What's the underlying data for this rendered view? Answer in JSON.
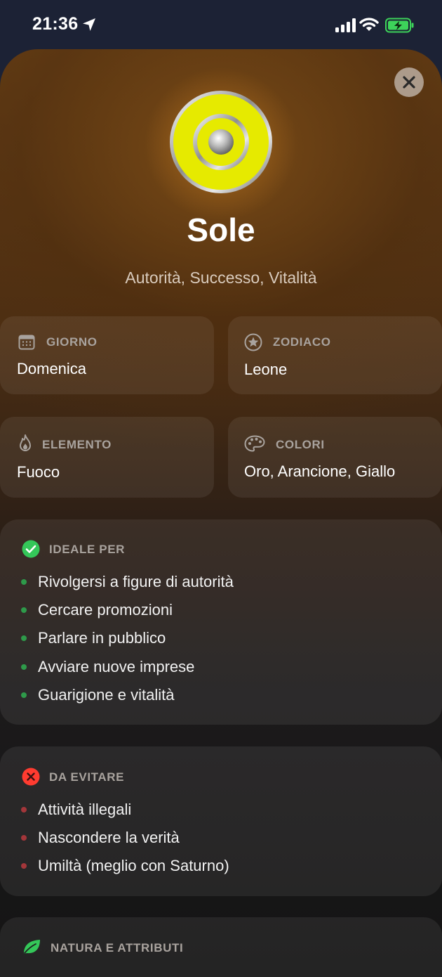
{
  "status_bar": {
    "time": "21:36"
  },
  "header": {
    "title": "Sole",
    "subtitle": "Autorità, Successo, Vitalità"
  },
  "cards": {
    "giorno": {
      "label": "GIORNO",
      "value": "Domenica"
    },
    "zodiaco": {
      "label": "ZODIACO",
      "value": "Leone"
    },
    "elemento": {
      "label": "ELEMENTO",
      "value": "Fuoco"
    },
    "colori": {
      "label": "COLORI",
      "value": "Oro, Arancione, Giallo"
    }
  },
  "ideale": {
    "label": "IDEALE PER",
    "items": [
      "Rivolgersi a figure di autorità",
      "Cercare promozioni",
      "Parlare in pubblico",
      "Avviare nuove imprese",
      "Guarigione e vitalità"
    ]
  },
  "evitare": {
    "label": "DA EVITARE",
    "items": [
      "Attività illegali",
      "Nascondere la verità",
      "Umiltà (meglio con Saturno)"
    ]
  },
  "natura": {
    "label": "NATURA E ATTRIBUTI"
  },
  "colors": {
    "accent_gold": "#e6ea00",
    "ok_green": "#34c759",
    "bad_red": "#ff3b30",
    "green_dot": "#2e9a4a",
    "red_dot": "#a3363a"
  },
  "icons": {
    "status": [
      "location-arrow-icon",
      "signal-icon",
      "wifi-icon",
      "battery-charging-icon"
    ],
    "cards": [
      "calendar-icon",
      "star-circle-icon",
      "flame-icon",
      "palette-icon"
    ],
    "sections": [
      "checkmark-circle-icon",
      "x-circle-icon",
      "leaf-icon"
    ]
  }
}
